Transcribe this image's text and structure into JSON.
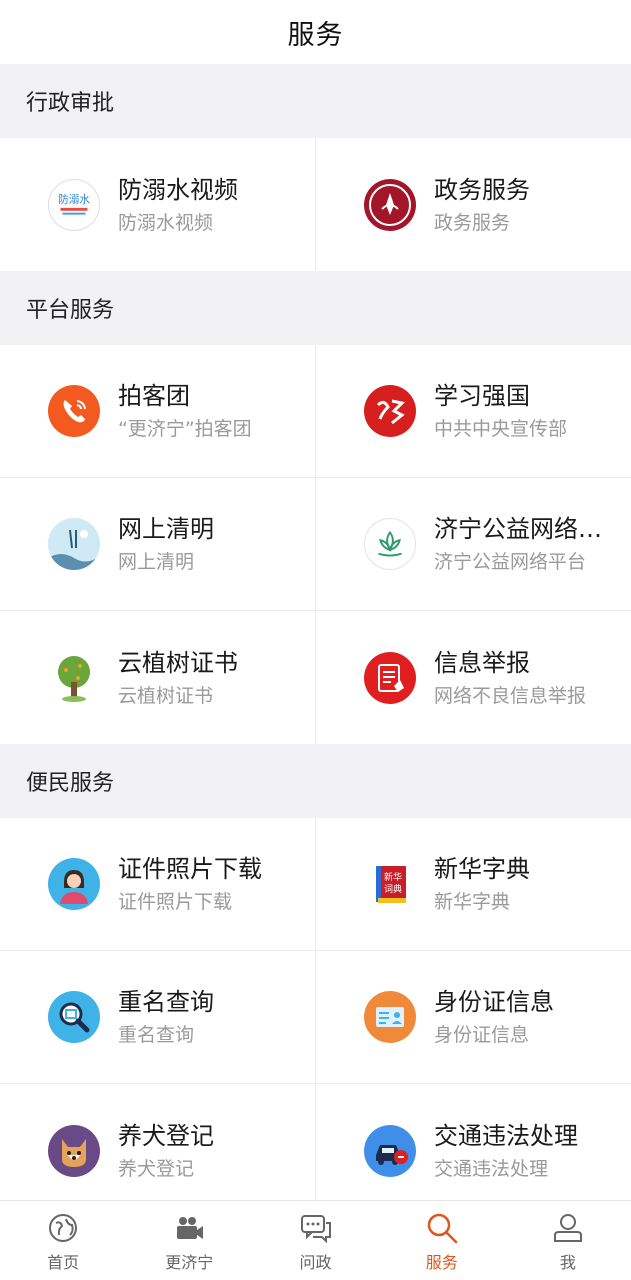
{
  "header": {
    "title": "服务"
  },
  "sections": [
    {
      "title": "行政审批",
      "items": [
        {
          "title": "防溺水视频",
          "sub": "防溺水视频",
          "icon": "drowning-prevention-logo-icon"
        },
        {
          "title": "政务服务",
          "sub": "政务服务",
          "icon": "government-seal-icon"
        }
      ]
    },
    {
      "title": "平台服务",
      "items": [
        {
          "title": "拍客团",
          "sub": "“更济宁”拍客团",
          "icon": "phone-icon"
        },
        {
          "title": "学习强国",
          "sub": "中共中央宣传部",
          "icon": "xuexi-logo-icon"
        },
        {
          "title": "网上清明",
          "sub": "网上清明",
          "icon": "qingming-painting-icon"
        },
        {
          "title": "济宁公益网络…",
          "sub": "济宁公益网络平台",
          "icon": "lotus-icon"
        },
        {
          "title": "云植树证书",
          "sub": "云植树证书",
          "icon": "tree-icon"
        },
        {
          "title": "信息举报",
          "sub": "网络不良信息举报",
          "icon": "report-document-icon"
        }
      ]
    },
    {
      "title": "便民服务",
      "items": [
        {
          "title": "证件照片下载",
          "sub": "证件照片下载",
          "icon": "id-photo-person-icon"
        },
        {
          "title": "新华字典",
          "sub": "新华字典",
          "icon": "dictionary-book-icon"
        },
        {
          "title": "重名查询",
          "sub": "重名查询",
          "icon": "name-search-magnifier-icon"
        },
        {
          "title": "身份证信息",
          "sub": "身份证信息",
          "icon": "id-card-icon"
        },
        {
          "title": "养犬登记",
          "sub": "养犬登记",
          "icon": "dog-face-icon"
        },
        {
          "title": "交通违法处理",
          "sub": "交通违法处理",
          "icon": "car-violation-icon"
        }
      ]
    }
  ],
  "tabbar": {
    "active_color": "#e0551b",
    "items": [
      {
        "label": "首页",
        "icon": "globe-icon"
      },
      {
        "label": "更济宁",
        "icon": "video-camera-icon"
      },
      {
        "label": "问政",
        "icon": "chat-bubbles-icon"
      },
      {
        "label": "服务",
        "icon": "search-icon",
        "active": true
      },
      {
        "label": "我",
        "icon": "user-icon"
      }
    ]
  }
}
